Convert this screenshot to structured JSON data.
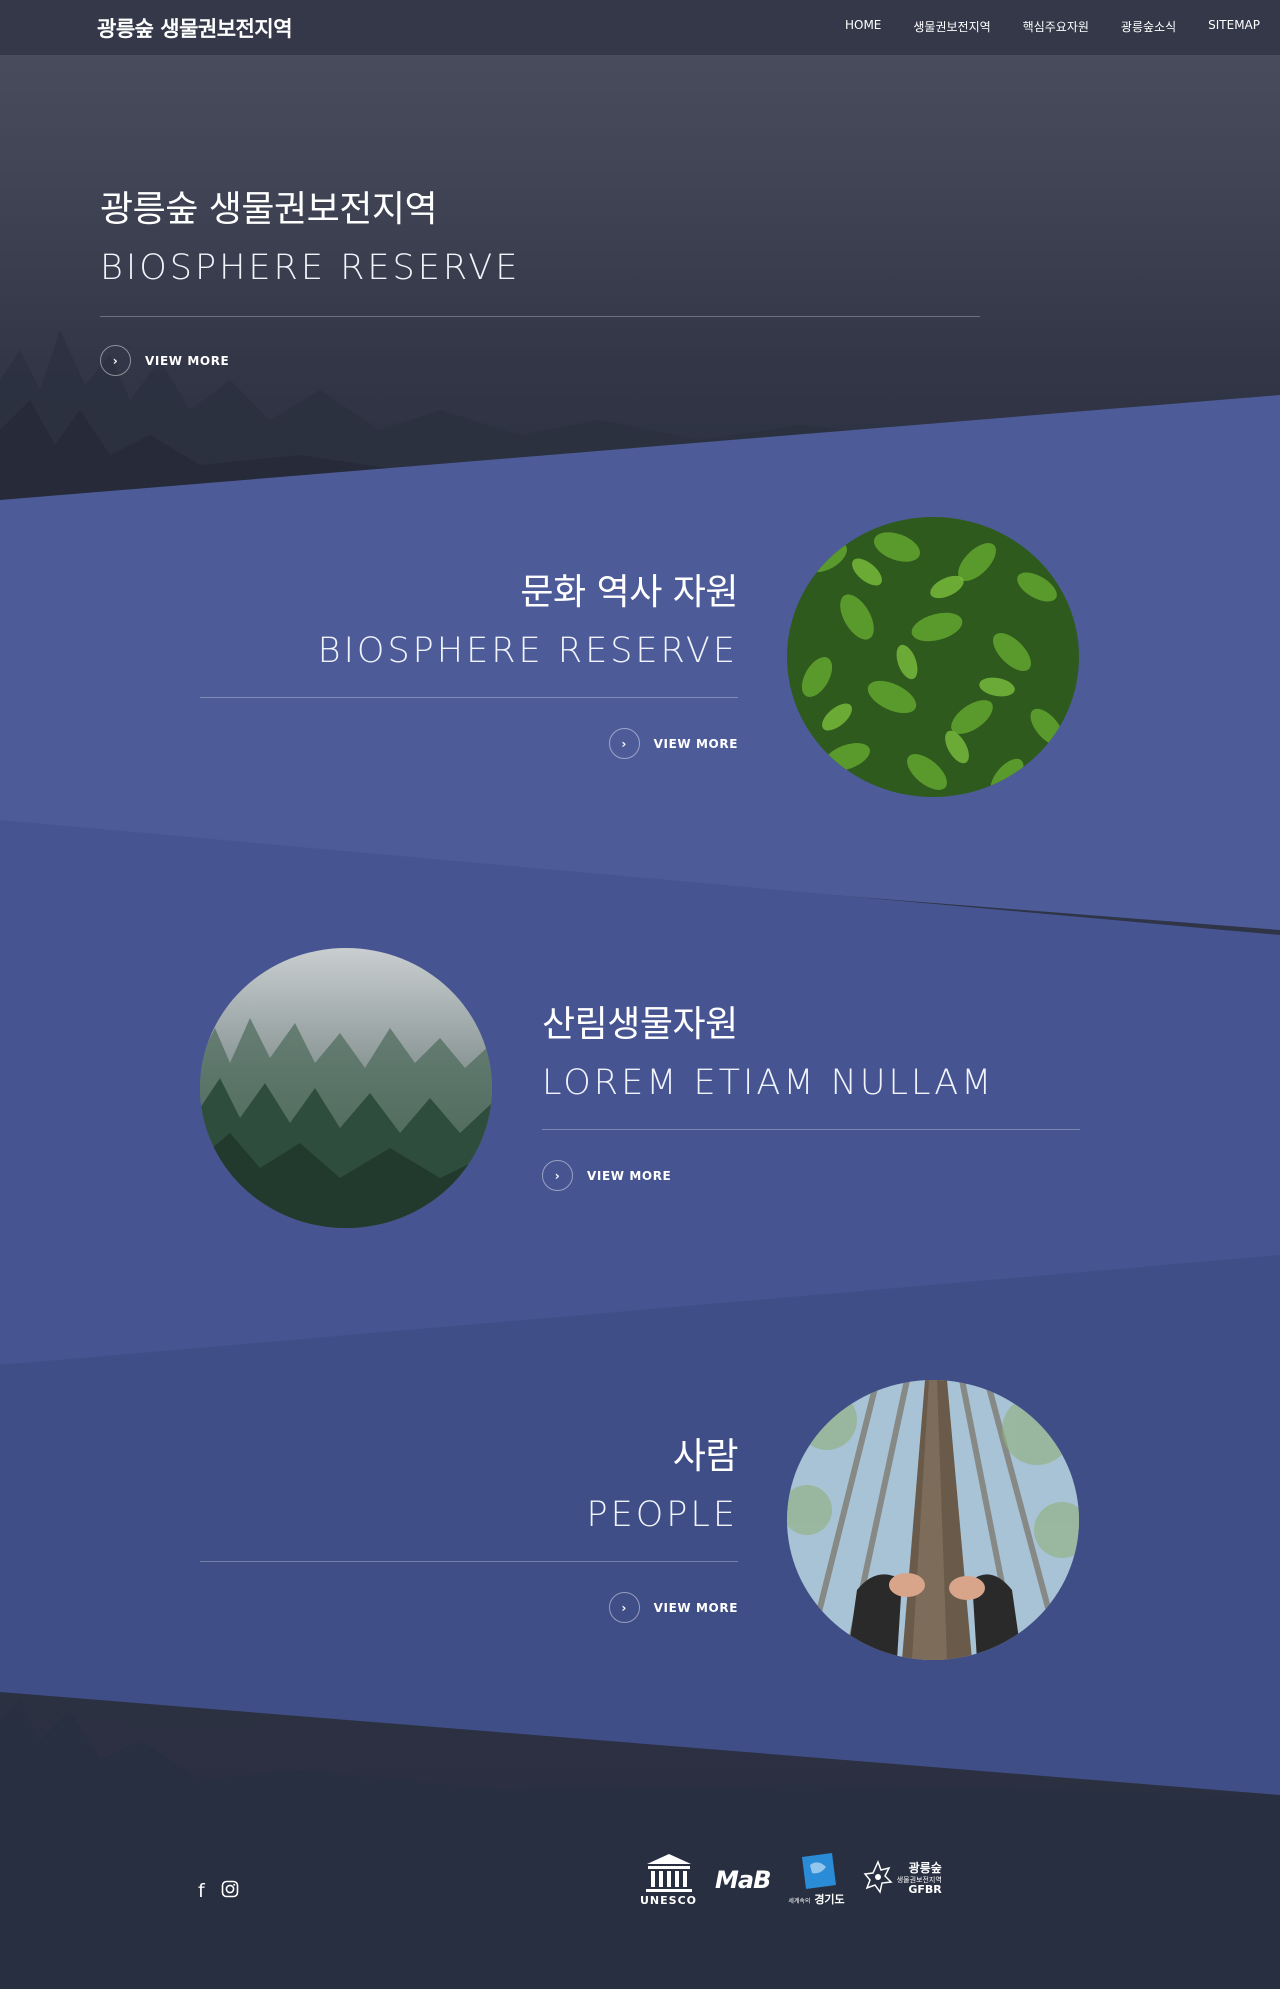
{
  "header": {
    "logo": "광릉숲 생물권보전지역",
    "nav": [
      "HOME",
      "생물권보전지역",
      "핵심주요자원",
      "광릉숲소식",
      "SITEMAP"
    ]
  },
  "hero": {
    "title_kr": "광릉숲 생물권보전지역",
    "title_en": "BIOSPHERE RESERVE",
    "more": "VIEW MORE"
  },
  "sections": [
    {
      "title_kr": "문화 역사 자원",
      "title_en": "BIOSPHERE RESERVE",
      "more": "VIEW MORE"
    },
    {
      "title_kr": "산림생물자원",
      "title_en": "LOREM ETIAM NULLAM",
      "more": "VIEW MORE"
    },
    {
      "title_kr": "사람",
      "title_en": "PEOPLE",
      "more": "VIEW MORE"
    }
  ],
  "footer": {
    "social": [
      "facebook-icon",
      "instagram-icon"
    ],
    "logos": {
      "unesco": "UNESCO",
      "mab": "MaB",
      "gyeonggi": "경기도",
      "gyeonggi_small": "세계속의",
      "gfbr_top": "광릉숲",
      "gfbr_mid": "생물권보전지역",
      "gfbr_bottom": "GFBR"
    }
  },
  "colors": {
    "band1": "#4d5c99",
    "band2": "#465591",
    "band3": "#3f4e86",
    "header": "#343849"
  }
}
